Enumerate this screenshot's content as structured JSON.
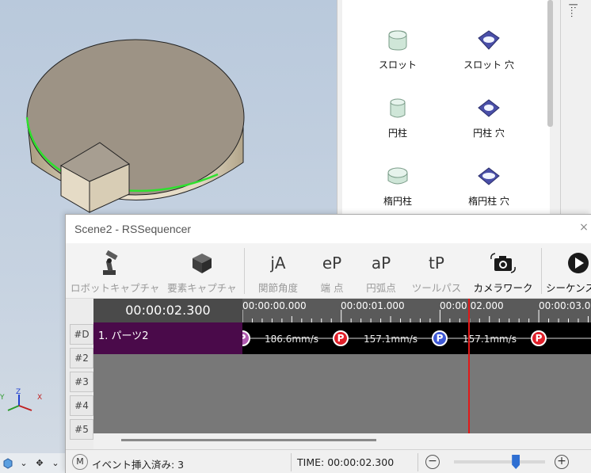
{
  "palette": {
    "items": [
      {
        "label": "スロット",
        "icon": "slot-icon"
      },
      {
        "label": "スロット 穴",
        "icon": "slot-hole-icon"
      },
      {
        "label": "円柱",
        "icon": "cylinder-icon"
      },
      {
        "label": "円柱 穴",
        "icon": "cylinder-hole-icon"
      },
      {
        "label": "楕円柱",
        "icon": "elliptic-cylinder-icon"
      },
      {
        "label": "楕円柱 穴",
        "icon": "elliptic-cylinder-hole-icon"
      }
    ]
  },
  "sequencer": {
    "title": "Scene2 - RSSequencer",
    "close_label": "×",
    "toolbar": [
      {
        "label": "ロボットキャプチャ",
        "icon": "robot-arm-icon",
        "enabled": false
      },
      {
        "label": "要素キャプチャ",
        "icon": "cube-icon",
        "enabled": false
      },
      {
        "label": "関節角度",
        "icon": "joint-angle-icon",
        "glyph": "jA",
        "enabled": false
      },
      {
        "label": "端 点",
        "icon": "end-point-icon",
        "glyph": "eP",
        "enabled": false
      },
      {
        "label": "円弧点",
        "icon": "arc-point-icon",
        "glyph": "aP",
        "enabled": false
      },
      {
        "label": "ツールパス",
        "icon": "tool-path-icon",
        "glyph": "tP",
        "enabled": false
      },
      {
        "label": "カメラワーク",
        "icon": "camera-icon",
        "enabled": true
      },
      {
        "label": "シーケンス",
        "icon": "play-icon",
        "enabled": true
      }
    ],
    "timeline": {
      "current_time": "00:00:02.300",
      "ruler_labels": [
        "00:00:00.000",
        "00:00:01.000",
        "00:00:02.000",
        "00:00:03.0"
      ],
      "rows": [
        "#D",
        "#2",
        "#3",
        "#4",
        "#5"
      ],
      "track_name": "1. パーツ2",
      "markers": [
        {
          "type": "P",
          "color": "#b05ab0"
        },
        {
          "type": "P",
          "color": "#e0202a"
        },
        {
          "type": "P",
          "color": "#3f59d6"
        },
        {
          "type": "P",
          "color": "#e0202a"
        }
      ],
      "speeds": [
        "186.6mm/s",
        "157.1mm/s",
        "157.1mm/s"
      ],
      "playhead_time_s": 2.3
    },
    "status": {
      "mode_badge": "M",
      "message": "イベント挿入済み: 3",
      "time_text": "TIME: 00:00:02.300",
      "zoom_minus": "−",
      "zoom_plus": "+",
      "zoom_level": 0.68
    }
  },
  "viewport": {
    "axis_labels": {
      "x": "X",
      "y": "Y",
      "z": "Z"
    },
    "right_strip_text": "|:…"
  },
  "colors": {
    "track_label_bg": "#4a0a4a",
    "playhead": "#e01818",
    "highlight_edge": "#2ee02e"
  }
}
